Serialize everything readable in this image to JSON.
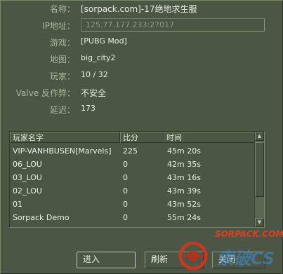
{
  "info": {
    "name_label": "名称：",
    "name_value": "[sorpack.com]-17绝地求生服",
    "ip_label": "IP地址：",
    "ip_value": "125.77.177.233:27017",
    "game_label": "游戏：",
    "game_value": "[PUBG Mod]",
    "map_label": "地图：",
    "map_value": "big_city2",
    "players_label": "玩家：",
    "players_value": "10 / 32",
    "vac_label": "Valve 反作弊：",
    "vac_value": "不安全",
    "ping_label": "延迟：",
    "ping_value": "173"
  },
  "players_table": {
    "headers": [
      "玩家名字",
      "比分",
      "时间"
    ],
    "rows": [
      [
        "VIP-VANHBUSEN[Marvels]",
        "225",
        "45m 20s"
      ],
      [
        "06_LOU",
        "0",
        "42m 35s"
      ],
      [
        "03_LOU",
        "0",
        "43m 16s"
      ],
      [
        "02_LOU",
        "0",
        "43m 39s"
      ],
      [
        "01",
        "0",
        "43m 52s"
      ],
      [
        "Sorpack Demo",
        "0",
        "55m 24s"
      ]
    ]
  },
  "buttons": {
    "join": "进入",
    "refresh": "刷新",
    "close": "关闭"
  },
  "watermark": {
    "text": "SORPACK.COM",
    "brand": "索破CS"
  },
  "colors": {
    "background": "#4b5744",
    "watermark_red": "#e23c25"
  }
}
